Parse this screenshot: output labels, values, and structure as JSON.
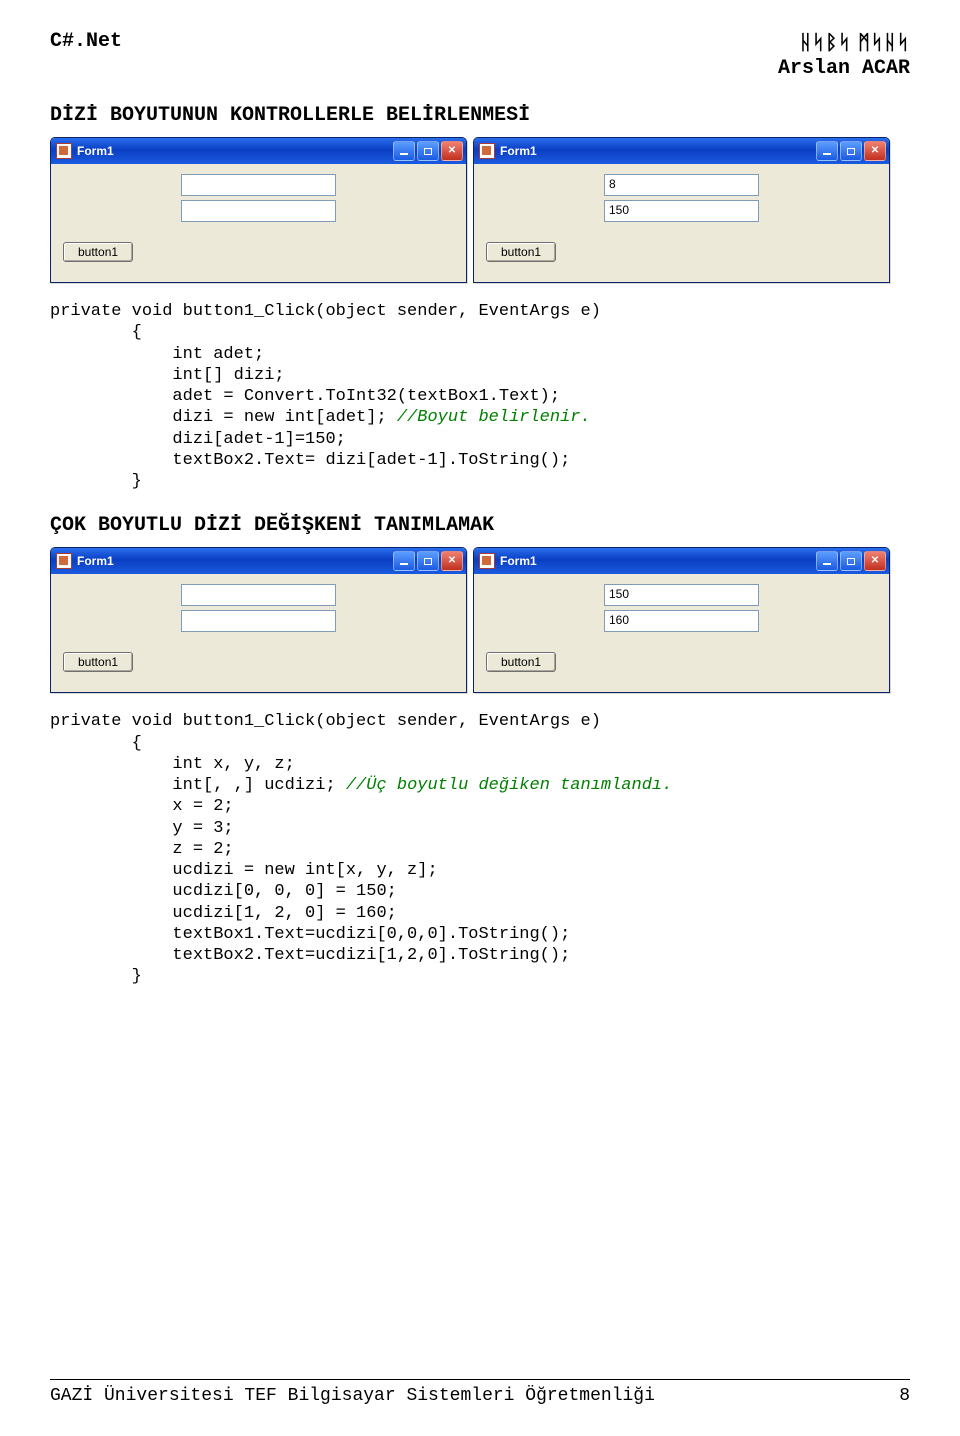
{
  "header": {
    "left": "C#.Net",
    "right_top": "ᚺᛋᛒᛋ ᛗᛋᚺᛋ",
    "right_bottom": "Arslan ACAR"
  },
  "section1": {
    "title": "DİZİ BOYUTUNUN KONTROLLERLE BELİRLENMESİ"
  },
  "section2": {
    "title": "ÇOK BOYUTLU DİZİ DEĞİŞKENİ TANIMLAMAK"
  },
  "forms": {
    "a": {
      "title": "Form1",
      "tb1": "",
      "tb2": "",
      "button": "button1"
    },
    "b": {
      "title": "Form1",
      "tb1": "8",
      "tb2": "150",
      "button": "button1"
    },
    "c": {
      "title": "Form1",
      "tb1": "",
      "tb2": "",
      "button": "button1"
    },
    "d": {
      "title": "Form1",
      "tb1": "150",
      "tb2": "160",
      "button": "button1"
    }
  },
  "code1": {
    "l1": "private void button1_Click(object sender, EventArgs e)",
    "l2": "        {",
    "l3": "            int adet;",
    "l4": "            int[] dizi;",
    "l5": "            adet = Convert.ToInt32(textBox1.Text);",
    "l6a": "            dizi = new int[adet]; ",
    "l6c": "//Boyut belirlenir.",
    "l7": "            dizi[adet-1]=150;",
    "l8": "            textBox2.Text= dizi[adet-1].ToString();",
    "l9": "        }"
  },
  "code2": {
    "l1": "private void button1_Click(object sender, EventArgs e)",
    "l2": "        {",
    "l3": "            int x, y, z;",
    "l4a": "            int[, ,] ucdizi; ",
    "l4c": "//Üç boyutlu değiken tanımlandı.",
    "l5": "            x = 2;",
    "l6": "            y = 3;",
    "l7": "            z = 2;",
    "l8": "            ucdizi = new int[x, y, z];",
    "l9": "            ucdizi[0, 0, 0] = 150;",
    "l10": "            ucdizi[1, 2, 0] = 160;",
    "l11": "            textBox1.Text=ucdizi[0,0,0].ToString();",
    "l12": "            textBox2.Text=ucdizi[1,2,0].ToString();",
    "l13": "        }"
  },
  "footer": {
    "left": "GAZİ Üniversitesi TEF Bilgisayar Sistemleri Öğretmenliği",
    "right": "8"
  }
}
